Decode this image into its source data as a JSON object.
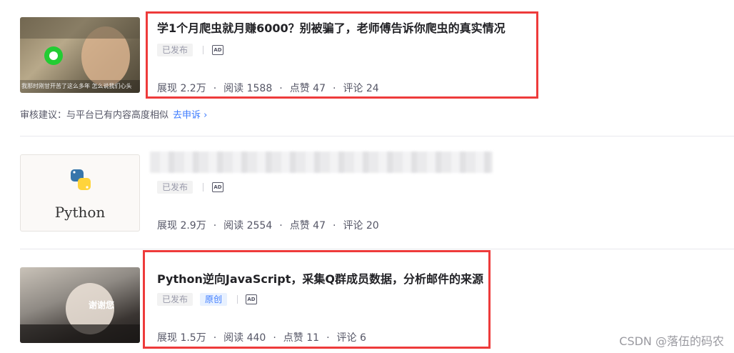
{
  "articles": [
    {
      "title": "学1个月爬虫就月赚6000？别被骗了，老师傅告诉你爬虫的真实情况",
      "status": "已发布",
      "ad": "AD",
      "thumb_caption": "我那时刚甘开苦了这么多年 怎么说我们心头",
      "stats": {
        "views": "展现 2.2万",
        "reads": "阅读 1588",
        "likes": "点赞 47",
        "comments": "评论 24"
      },
      "audit_note": "审核建议：与平台已有内容高度相似",
      "audit_link": "去申诉 ›"
    },
    {
      "title": "",
      "status": "已发布",
      "ad": "AD",
      "thumb_label": "Python",
      "stats": {
        "views": "展现 2.9万",
        "reads": "阅读 2554",
        "likes": "点赞 47",
        "comments": "评论 20"
      }
    },
    {
      "title": "Python逆向JavaScript，采集Q群成员数据，分析邮件的来源",
      "status": "已发布",
      "original": "原创",
      "ad": "AD",
      "thumb_caption": "谢谢您",
      "stats": {
        "views": "展现 1.5万",
        "reads": "阅读 440",
        "likes": "点赞 11",
        "comments": "评论 6"
      }
    }
  ],
  "watermark": "CSDN @落伍的码农",
  "colors": {
    "highlight": "#ee3b3b",
    "link": "#3c7bff"
  }
}
